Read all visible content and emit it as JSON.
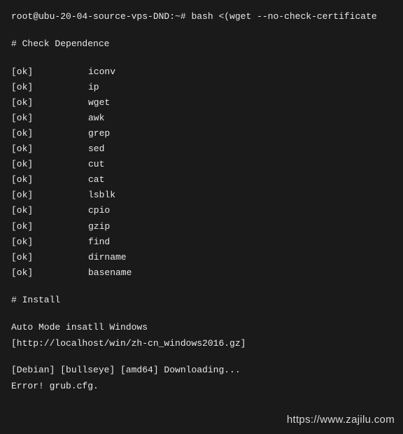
{
  "prompt": {
    "full": "root@ubu-20-04-source-vps-DND:~# bash <(wget --no-check-certificate"
  },
  "check_dependence": {
    "header": "# Check Dependence",
    "rows": [
      {
        "status": "[ok]",
        "name": "iconv"
      },
      {
        "status": "[ok]",
        "name": "ip"
      },
      {
        "status": "[ok]",
        "name": "wget"
      },
      {
        "status": "[ok]",
        "name": "awk"
      },
      {
        "status": "[ok]",
        "name": "grep"
      },
      {
        "status": "[ok]",
        "name": "sed"
      },
      {
        "status": "[ok]",
        "name": "cut"
      },
      {
        "status": "[ok]",
        "name": "cat"
      },
      {
        "status": "[ok]",
        "name": "lsblk"
      },
      {
        "status": "[ok]",
        "name": "cpio"
      },
      {
        "status": "[ok]",
        "name": "gzip"
      },
      {
        "status": "[ok]",
        "name": "find"
      },
      {
        "status": "[ok]",
        "name": "dirname"
      },
      {
        "status": "[ok]",
        "name": "basename"
      }
    ]
  },
  "install": {
    "header": "# Install",
    "auto_mode": "Auto Mode insatll Windows",
    "url": "[http://localhost/win/zh-cn_windows2016.gz]",
    "download": "[Debian] [bullseye] [amd64] Downloading...",
    "error": "Error! grub.cfg."
  },
  "watermark": "https://www.zajilu.com"
}
